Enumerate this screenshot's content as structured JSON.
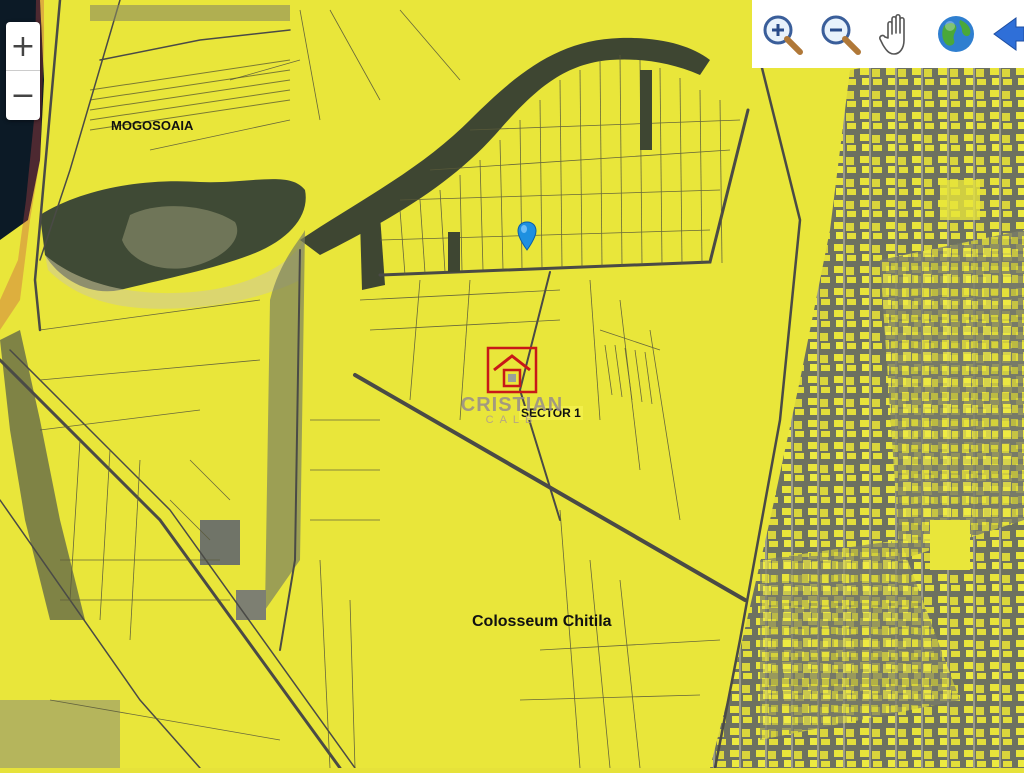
{
  "map": {
    "labels": {
      "mogosoaia": "MOGOSOAIA",
      "sector": "SECTOR 1",
      "colosseum": "Colosseum Chitila"
    },
    "watermark": {
      "brand": "CRISTIAN",
      "sub": "CALB"
    },
    "colors": {
      "parcel": "#ecec3c",
      "urban": "#6f7360",
      "road": "#4a4a46",
      "water": "#0c1a26",
      "marker": "#1e90e0"
    }
  },
  "controls": {
    "zoom_in": "+",
    "zoom_out": "−"
  },
  "toolbar": {
    "tools": [
      {
        "name": "zoom-in-magnifier-icon"
      },
      {
        "name": "zoom-out-magnifier-icon"
      },
      {
        "name": "pan-hand-icon"
      },
      {
        "name": "globe-icon"
      },
      {
        "name": "back-arrow-icon"
      }
    ]
  }
}
